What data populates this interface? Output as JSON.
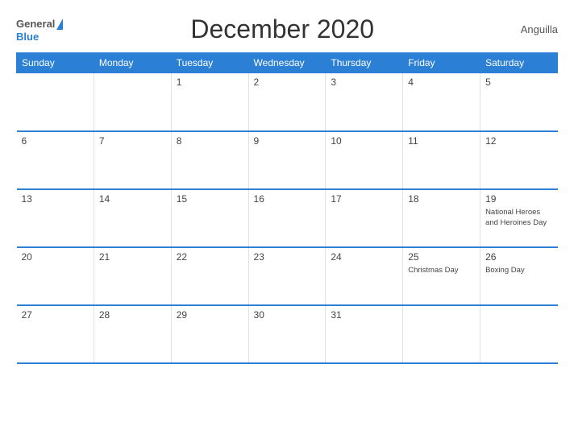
{
  "header": {
    "logo_general": "General",
    "logo_blue": "Blue",
    "title": "December 2020",
    "country": "Anguilla"
  },
  "columns": [
    "Sunday",
    "Monday",
    "Tuesday",
    "Wednesday",
    "Thursday",
    "Friday",
    "Saturday"
  ],
  "weeks": [
    [
      {
        "day": "",
        "event": "",
        "empty": true
      },
      {
        "day": "",
        "event": "",
        "empty": true
      },
      {
        "day": "1",
        "event": ""
      },
      {
        "day": "2",
        "event": ""
      },
      {
        "day": "3",
        "event": ""
      },
      {
        "day": "4",
        "event": ""
      },
      {
        "day": "5",
        "event": ""
      }
    ],
    [
      {
        "day": "6",
        "event": ""
      },
      {
        "day": "7",
        "event": ""
      },
      {
        "day": "8",
        "event": ""
      },
      {
        "day": "9",
        "event": ""
      },
      {
        "day": "10",
        "event": ""
      },
      {
        "day": "11",
        "event": ""
      },
      {
        "day": "12",
        "event": ""
      }
    ],
    [
      {
        "day": "13",
        "event": ""
      },
      {
        "day": "14",
        "event": ""
      },
      {
        "day": "15",
        "event": ""
      },
      {
        "day": "16",
        "event": ""
      },
      {
        "day": "17",
        "event": ""
      },
      {
        "day": "18",
        "event": ""
      },
      {
        "day": "19",
        "event": "National Heroes and Heroines Day"
      }
    ],
    [
      {
        "day": "20",
        "event": ""
      },
      {
        "day": "21",
        "event": ""
      },
      {
        "day": "22",
        "event": ""
      },
      {
        "day": "23",
        "event": ""
      },
      {
        "day": "24",
        "event": ""
      },
      {
        "day": "25",
        "event": "Christmas Day"
      },
      {
        "day": "26",
        "event": "Boxing Day"
      }
    ],
    [
      {
        "day": "27",
        "event": ""
      },
      {
        "day": "28",
        "event": ""
      },
      {
        "day": "29",
        "event": ""
      },
      {
        "day": "30",
        "event": ""
      },
      {
        "day": "31",
        "event": ""
      },
      {
        "day": "",
        "event": "",
        "empty": true
      },
      {
        "day": "",
        "event": "",
        "empty": true
      }
    ]
  ]
}
